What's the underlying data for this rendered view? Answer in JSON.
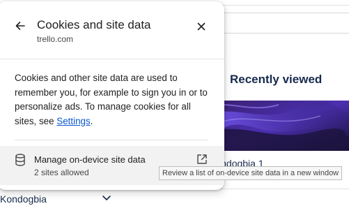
{
  "popup": {
    "title": "Cookies and site data",
    "subtitle": "trello.com",
    "description_before_link": "Cookies and other site data are used to remember you, for example to sign you in or to personalize ads. To manage cookies for all sites, see ",
    "link_label": "Settings",
    "description_after_link": ".",
    "manage": {
      "title": "Manage on-device site data",
      "subtitle": "2 sites allowed"
    },
    "icons": {
      "back": "back-arrow-icon",
      "close": "close-icon",
      "manage": "database-icon",
      "open": "open-in-new-icon"
    }
  },
  "tooltip": {
    "text": "Review a list of on-device site data in a new window"
  },
  "background": {
    "recently_viewed_title": "Recently viewed",
    "board_name": "Kondogbia 1",
    "sidebar_item": "Kondogbia"
  },
  "colors": {
    "link": "#0b57d0",
    "manage_row_bg": "#f2f2f2",
    "trello_text": "#172b4d"
  }
}
